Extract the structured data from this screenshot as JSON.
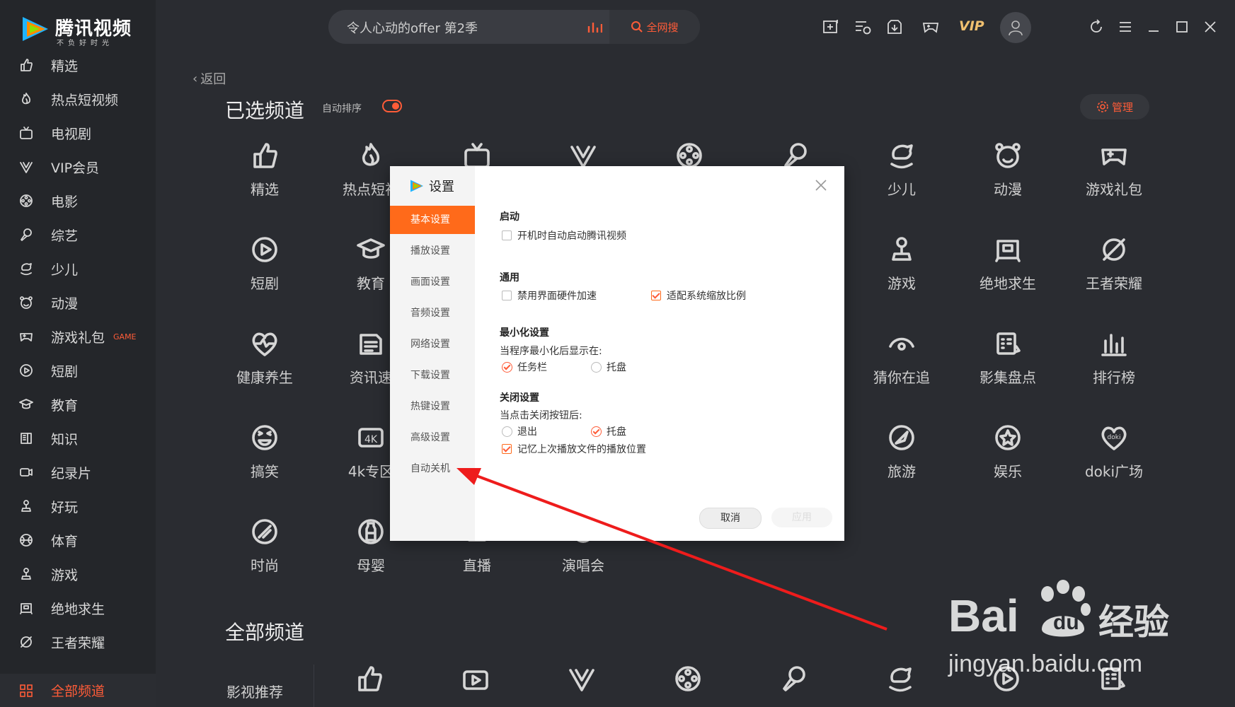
{
  "app": {
    "logo_title": "腾讯视频",
    "logo_subtitle": "不负好时光"
  },
  "search": {
    "query": "令人心动的offer 第2季",
    "button": "全网搜"
  },
  "topbar": {
    "vip": "VIP"
  },
  "sidebar": {
    "items": [
      {
        "label": "精选",
        "icon": "thumbs-up-icon"
      },
      {
        "label": "热点短视频",
        "icon": "flame-icon"
      },
      {
        "label": "电视剧",
        "icon": "tv-icon"
      },
      {
        "label": "VIP会员",
        "icon": "vip-v-icon"
      },
      {
        "label": "电影",
        "icon": "film-reel-icon"
      },
      {
        "label": "综艺",
        "icon": "microphone-icon"
      },
      {
        "label": "少儿",
        "icon": "rocking-horse-icon"
      },
      {
        "label": "动漫",
        "icon": "cartoon-face-icon"
      },
      {
        "label": "游戏礼包",
        "icon": "gamepad-icon",
        "tag": "GAME"
      },
      {
        "label": "短剧",
        "icon": "play-circle-icon"
      },
      {
        "label": "教育",
        "icon": "graduation-cap-icon"
      },
      {
        "label": "知识",
        "icon": "book-icon"
      },
      {
        "label": "纪录片",
        "icon": "camera-icon"
      },
      {
        "label": "好玩",
        "icon": "joystick-icon"
      },
      {
        "label": "体育",
        "icon": "ball-icon"
      },
      {
        "label": "游戏",
        "icon": "joystick-icon"
      },
      {
        "label": "绝地求生",
        "icon": "crate-icon"
      },
      {
        "label": "王者荣耀",
        "icon": "crest-icon"
      }
    ],
    "all_channels": "全部频道"
  },
  "main": {
    "back": "返回",
    "selected_title": "已选频道",
    "auto_sort": "自动排序",
    "manage": "管理",
    "all_title": "全部频道",
    "category": "影视推荐",
    "selected_channels": [
      [
        "精选",
        "热点短视",
        "",
        "",
        "",
        "",
        "少儿",
        "动漫",
        "游戏礼包"
      ],
      [
        "短剧",
        "教育",
        "",
        "",
        "",
        "",
        "游戏",
        "绝地求生",
        "王者荣耀"
      ],
      [
        "健康养生",
        "资讯速",
        "",
        "",
        "",
        "",
        "猜你在追",
        "影集盘点",
        "排行榜"
      ],
      [
        "搞笑",
        "4k专区",
        "",
        "",
        "",
        "",
        "旅游",
        "娱乐",
        "doki广场"
      ],
      [
        "时尚",
        "母婴",
        "直播",
        "演唱会"
      ]
    ]
  },
  "dialog": {
    "title": "设置",
    "menu": [
      "基本设置",
      "播放设置",
      "画面设置",
      "音频设置",
      "网络设置",
      "下载设置",
      "热键设置",
      "高级设置",
      "自动关机"
    ],
    "startup_title": "启动",
    "startup_opt": "开机时自动启动腾讯视频",
    "general_title": "通用",
    "general_opt1": "禁用界面硬件加速",
    "general_opt2": "适配系统缩放比例",
    "min_title": "最小化设置",
    "min_label": "当程序最小化后显示在:",
    "min_opt1": "任务栏",
    "min_opt2": "托盘",
    "close_title": "关闭设置",
    "close_label": "当点击关闭按钮后:",
    "close_opt1": "退出",
    "close_opt2": "托盘",
    "remember_opt": "记忆上次播放文件的播放位置",
    "cancel": "取消",
    "apply": "应用"
  },
  "watermark": {
    "brand": "Bai",
    "du": "du",
    "jingyan": "经验",
    "url": "jingyan.baidu.com"
  },
  "colors": {
    "accent": "#ff5c38",
    "dialog_accent": "#ff6a1a",
    "bg": "#2a2c31",
    "sidebar": "#24262a"
  }
}
